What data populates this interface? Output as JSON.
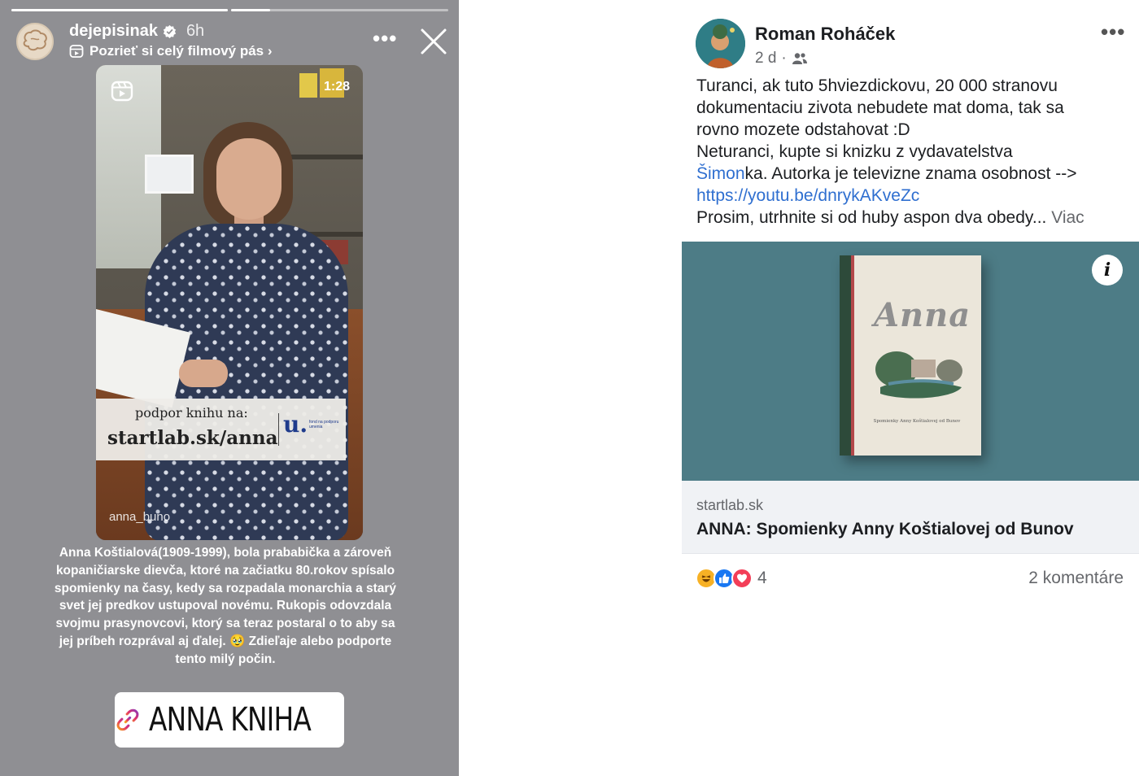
{
  "story": {
    "username": "dejepisinak",
    "time": "6h",
    "subtitle": "Pozrieť si celý filmový pás ›",
    "more_icon": "more-horizontal-icon",
    "close_icon": "close-icon",
    "progress": [
      1.0,
      0.18
    ],
    "video": {
      "duration": "1:28",
      "banner_line1": "podpor knihu na:",
      "banner_line2": "startlab.sk/anna",
      "banner_logo": "u.",
      "banner_logo_small": "fond na podporu umenia",
      "watermark": "anna_buno"
    },
    "caption": "Anna Koštialová(1909-1999), bola prababička a zároveň kopaničiarske dievča, ktoré na začiatku 80.rokov spísalo spomienky na časy, kedy sa rozpadala monarchia a starý svet jej predkov ustupoval novému. Rukopis odovzdala svojmu prasynovcovi, ktorý sa teraz postaral o to aby sa jej príbeh rozprával aj ďalej. 🥹 Zdieľaje alebo podporte tento milý počin.",
    "link_sticker": "ANNA KNIHA"
  },
  "post": {
    "author": "Roman Roháček",
    "time": "2 d",
    "separator": "·",
    "audience_icon": "friends-icon",
    "lines": {
      "l1": "Turanci, ak tuto 5hviezdickovu, 20 000 stranovu",
      "l2": "dokumentaciu zivota nebudete mat doma, tak sa",
      "l3": "rovno mozete odstahovat :D",
      "l4": "Neturanci, kupte si knizku z vydavatelstva",
      "l5_link": "Šimon",
      "l5_rest": "ka. Autorka je televizne znama osobnost -->",
      "l6_link": "https://youtu.be/dnrykAKveZc",
      "l7": "Prosim, utrhnite si od huby aspon dva obedy...",
      "see_more": "Viac"
    },
    "book": {
      "title": "Anna",
      "subtitle": "Spomienky Anny Koštialovej od Bunov"
    },
    "info_label": "i",
    "link_domain": "startlab.sk",
    "link_title": "ANNA: Spomienky Anny Koštialovej od Bunov",
    "reactions": [
      "haha",
      "like",
      "love"
    ],
    "reaction_count": "4",
    "comments": "2 komentáre"
  },
  "colors": {
    "story_bg": "#8f8f93",
    "fb_link": "#2f6fd0",
    "fb_muted": "#65676b",
    "image_bg": "#4d7c86",
    "like": "#1877f2",
    "love": "#f33e58",
    "haha": "#f7b125"
  }
}
